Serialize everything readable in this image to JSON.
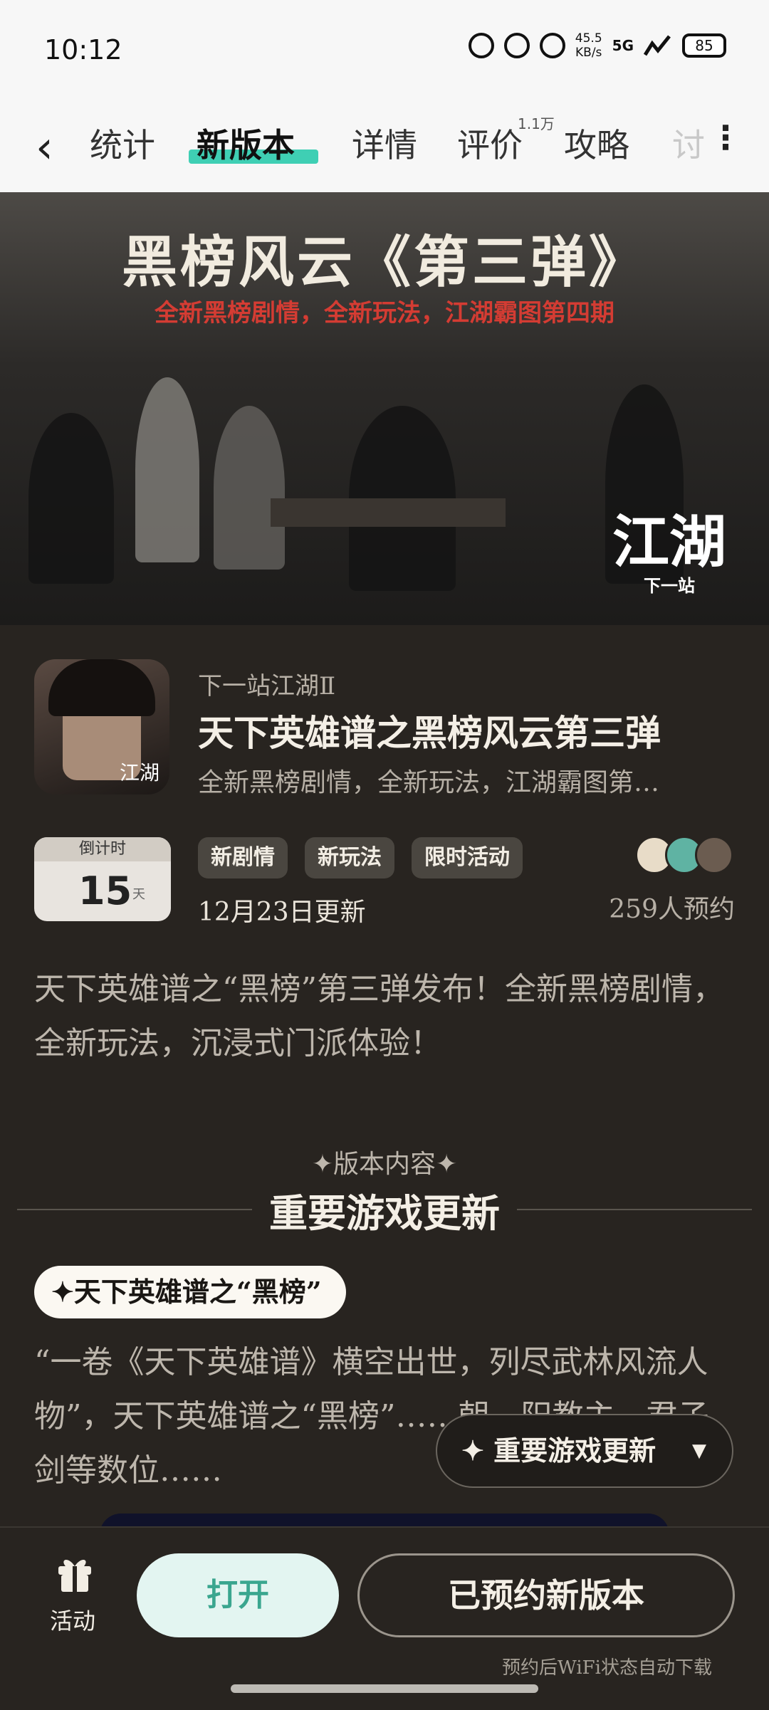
{
  "status_bar": {
    "time": "10:12",
    "net_speed_value": "45.5",
    "net_speed_unit": "KB/s",
    "network": "5G",
    "battery": "85"
  },
  "nav": {
    "tabs": [
      "统计",
      "新版本",
      "详情",
      "评价",
      "攻略",
      "讨"
    ],
    "active_tab_index": 1,
    "review_count_sup": "1.1万",
    "accent_color": "#3fcfb4"
  },
  "banner": {
    "title": "黑榜风云《第三弹》",
    "subtitle": "全新黑榜剧情，全新玩法，江湖霸图第四期",
    "logo_text": "江湖",
    "logo_sub": "下一站"
  },
  "app": {
    "icon_text": "江湖",
    "developer_line": "下一站江湖Ⅱ",
    "title": "天下英雄谱之黑榜风云第三弹",
    "subtitle": "全新黑榜剧情，全新玩法，江湖霸图第…"
  },
  "countdown": {
    "label": "倒计时",
    "number": "15",
    "unit": "天"
  },
  "tags": [
    "新剧情",
    "新玩法",
    "限时活动"
  ],
  "update_date": "12月23日更新",
  "reservations": "259人预约",
  "description": "天下英雄谱之“黑榜”第三弹发布！全新黑榜剧情，全新玩法，沉浸式门派体验！",
  "section": {
    "kicker": "✦版本内容✦",
    "title": "重要游戏更新",
    "pill_label": "✦天下英雄谱之“黑榜”",
    "body": "“一卷《天下英雄谱》横空出世，列尽武林风流人物”，天下英雄谱之“黑榜”……朝、阳教主、君子剑等数位……"
  },
  "floating_button": {
    "label": "✦ 重要游戏更新",
    "caret": "▼"
  },
  "bottom_bar": {
    "activity_label": "活动",
    "open_label": "打开",
    "reserved_label": "已预约新版本",
    "wifi_note": "预约后WiFi状态自动下载"
  }
}
